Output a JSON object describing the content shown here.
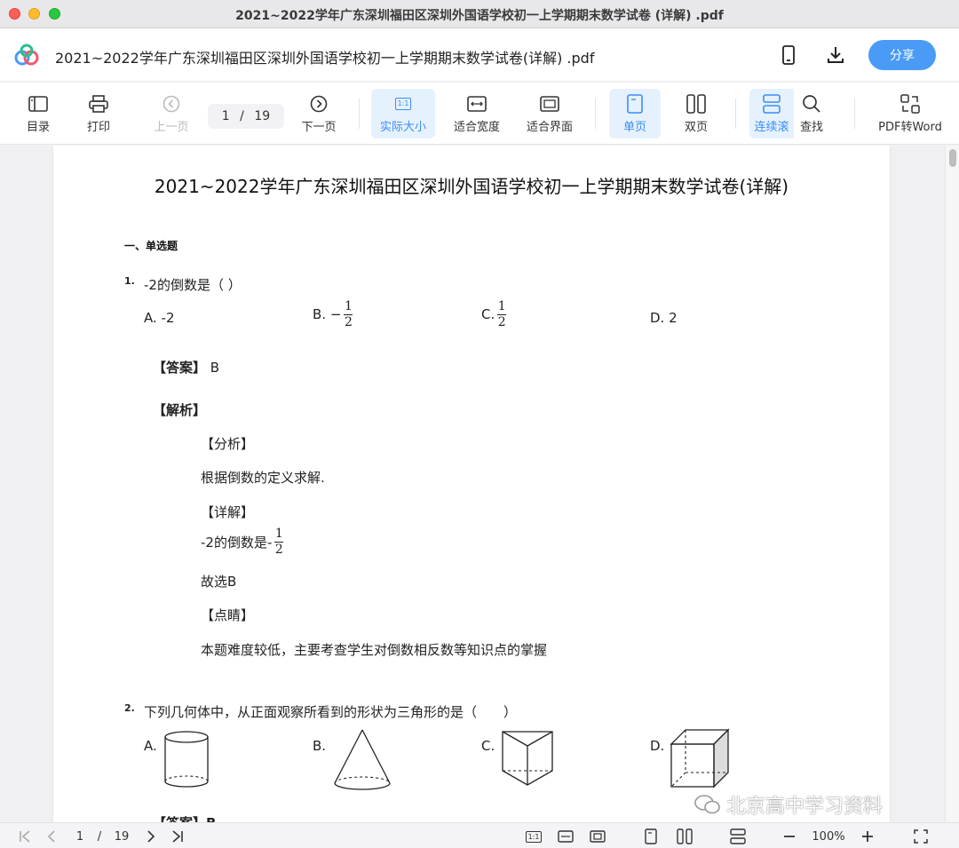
{
  "window": {
    "title": "2021~2022学年广东深圳福田区深圳外国语学校初一上学期期末数学试卷 (详解) .pdf"
  },
  "header": {
    "doc_title": "2021~2022学年广东深圳福田区深圳外国语学校初一上学期期末数学试卷(详解) .pdf",
    "share_label": "分享",
    "icons": [
      "phone-icon",
      "download-icon"
    ]
  },
  "toolbar": {
    "toc": "目录",
    "print": "打印",
    "prev": "上一页",
    "page_current": "1",
    "page_sep": "/",
    "page_total": "19",
    "next": "下一页",
    "actual_size": "实际大小",
    "actual_size_glyph": "1:1",
    "fit_width": "适合宽度",
    "fit_page": "适合界面",
    "single": "单页",
    "double": "双页",
    "continuous": "连续滚",
    "find": "查找",
    "pdf_to_word": "PDF转Word",
    "accent": "#3a8ef5"
  },
  "document": {
    "title": "2021~2022学年广东深圳福田区深圳外国语学校初一上学期期末数学试卷(详解)",
    "section": "一、单选题",
    "q1": {
      "num": "1.",
      "text": "-2的倒数是（ ）",
      "a": "A. -2",
      "b_prefix": "B. −",
      "c_prefix": "C.",
      "frac_num": "1",
      "frac_den": "2",
      "d": "D. 2",
      "answer_label": "【答案】",
      "answer": "B",
      "analysis_label": "【解析】",
      "fenxi_label": "【分析】",
      "fenxi": "根据倒数的定义求解.",
      "xiangjie_label": "【详解】",
      "xiangjie_prefix": "-2的倒数是-",
      "guxuan": "故选B",
      "dianjing_label": "【点睛】",
      "dianjing": "本题难度较低，主要考查学生对倒数相反数等知识点的掌握"
    },
    "q2": {
      "num": "2.",
      "text": "下列几何体中，从正面观察所看到的形状为三角形的是（　　）",
      "a": "A.",
      "b": "B.",
      "c": "C.",
      "d": "D.",
      "answer_label_partial": "【答案】B"
    }
  },
  "watermark": "北京高中学习资料",
  "bottombar": {
    "page_current": "1",
    "page_sep": "/",
    "page_total": "19",
    "zoom": "100%",
    "actual_glyph": "1:1"
  }
}
